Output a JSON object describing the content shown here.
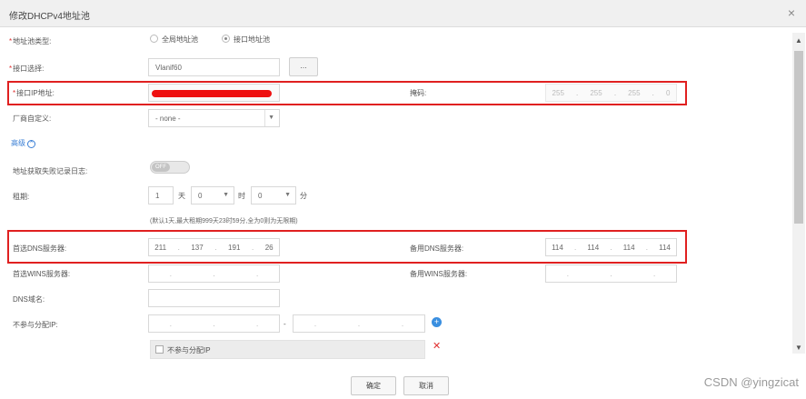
{
  "dialog": {
    "title": "修改DHCPv4地址池",
    "close": "×"
  },
  "form": {
    "pool_type": {
      "label": "地址池类型:",
      "options": [
        "全局地址池",
        "接口地址池"
      ],
      "selected": "接口地址池"
    },
    "interface": {
      "label": "接口选择:",
      "value": "Vlanif60",
      "browse_label": "..."
    },
    "interface_ip": {
      "label": "接口IP地址:"
    },
    "mask": {
      "label": "掩码:",
      "octets": [
        "255",
        "255",
        "255",
        "0"
      ]
    },
    "vendor": {
      "label": "厂商自定义:",
      "value": "- none -"
    },
    "advanced": {
      "label": "高级"
    },
    "log_conflict": {
      "label": "地址获取失败记录日志:",
      "state": "OFF"
    },
    "lease": {
      "label": "租期:",
      "days": "1",
      "days_unit": "天",
      "hours": "0",
      "hours_unit": "时",
      "minutes": "0",
      "minutes_unit": "分",
      "hint": "(默认1天,最大租期999天23时59分,全为0则为无限期)"
    },
    "primary_dns": {
      "label": "首选DNS服务器:",
      "octets": [
        "211",
        "137",
        "191",
        "26"
      ]
    },
    "secondary_dns": {
      "label": "备用DNS服务器:",
      "octets": [
        "114",
        "114",
        "114",
        "114"
      ]
    },
    "primary_wins": {
      "label": "首选WINS服务器:"
    },
    "secondary_wins": {
      "label": "备用WINS服务器:"
    },
    "dns_suffix": {
      "label": "DNS域名:"
    },
    "excluded_ip": {
      "label": "不参与分配IP:",
      "range_sep": "-",
      "row_label": "不参与分配IP"
    }
  },
  "footer": {
    "ok": "确定",
    "cancel": "取消"
  },
  "watermark": "CSDN @yingzicat",
  "colors": {
    "highlight_box": "#e02020",
    "link_blue": "#3a7fd5",
    "required": "#e03030"
  }
}
